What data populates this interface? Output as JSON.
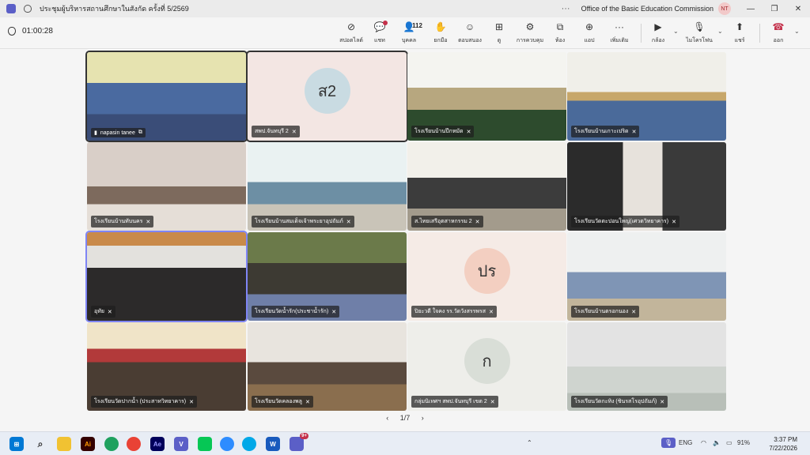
{
  "window": {
    "title": "ประชุมผู้บริหารสถานศึกษาในสังกัด ครั้งที่ 5/2569",
    "org": "Office of the Basic Education Commission",
    "user_initials": "NT",
    "more": "···"
  },
  "meeting": {
    "timer": "01:00:28",
    "participants_count": "112"
  },
  "toolbar": {
    "items": [
      {
        "label": "สปอตไลต์",
        "icon": "no-video-icon"
      },
      {
        "label": "แชท",
        "icon": "chat-icon"
      },
      {
        "label": "บุคคล",
        "icon": "people-icon"
      },
      {
        "label": "ยกมือ",
        "icon": "hand-icon"
      },
      {
        "label": "ตอบสนอง",
        "icon": "smile-icon"
      },
      {
        "label": "ดู",
        "icon": "grid-icon"
      },
      {
        "label": "การควบคุม",
        "icon": "shield-gear-icon"
      },
      {
        "label": "ห้อง",
        "icon": "rooms-icon"
      },
      {
        "label": "แอป",
        "icon": "plus-icon"
      },
      {
        "label": "เพิ่มเติม",
        "icon": "more-icon"
      },
      {
        "label": "กล้อง",
        "icon": "camera-icon"
      },
      {
        "label": "ไมโครโฟน",
        "icon": "mic-icon"
      },
      {
        "label": "แชร์",
        "icon": "share-icon"
      },
      {
        "label": "ออก",
        "icon": "hangup-icon"
      }
    ]
  },
  "tiles": [
    {
      "name": "napasin tanee"
    },
    {
      "name": "สพป.จันทบุรี 2",
      "avatar": "ส2"
    },
    {
      "name": "โรงเรียนบ้านปึกหมัด"
    },
    {
      "name": "โรงเรียนบ้านเกาะเปริด"
    },
    {
      "name": "โรงเรียนบ้านทับนคร"
    },
    {
      "name": "โรงเรียนบ้านสมเด็จเจ้าพระยาอุปถัมภ์"
    },
    {
      "name": "ส.ไทยเสรีอุตสาหกรรม 2"
    },
    {
      "name": "โรงเรียนวัดตะปอนใหญ่(เศวตวิทยาคาร)"
    },
    {
      "name": "อุทัย"
    },
    {
      "name": "โรงเรียนวัดน้ำรัก(ประชาน้ำรัก)"
    },
    {
      "name": "ปิยะวดี ใจคง รร.วัดวังสรรพรส",
      "avatar": "ปร"
    },
    {
      "name": "โรงเรียนบ้านตรอกนอง"
    },
    {
      "name": "โรงเรียนวัดปากน้ำ (ประสาทวิทยาคาร)"
    },
    {
      "name": "โรงเรียนวัดคลองพลู"
    },
    {
      "name": "กลุ่มนิเทศฯ สพป.จันทบุรี เขต 2",
      "avatar": "ก"
    },
    {
      "name": "โรงเรียนวัดกะทิง (ชินรสโรอุปถัมภ์)"
    }
  ],
  "pager": {
    "prev": "‹",
    "text": "1/7",
    "next": "›"
  },
  "taskbar": {
    "apps": [
      "Ai",
      "Ae",
      "V",
      "W"
    ],
    "teams_badge": "9+",
    "lang": "ENG",
    "battery": "91%",
    "time": "3:37 PM",
    "date": "7/22/2026"
  },
  "colors": {
    "accent": "#5b5fc7",
    "leave": "#c4314b",
    "active_outline": "#7f85f5"
  }
}
